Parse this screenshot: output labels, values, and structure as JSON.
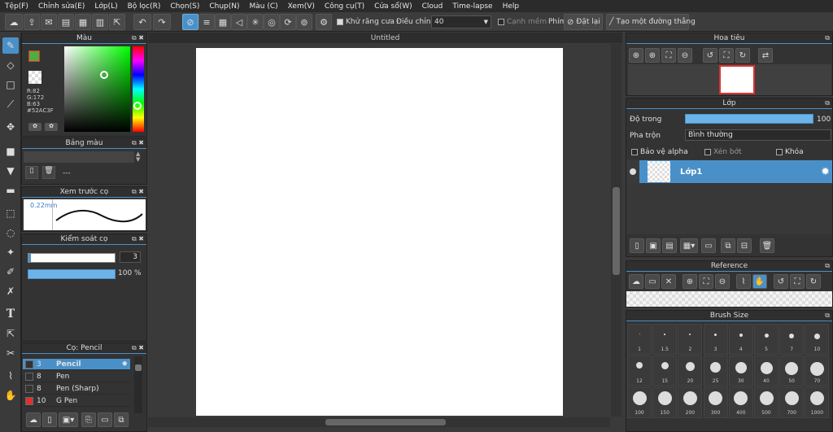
{
  "menubar": {
    "items": [
      "Tệp(F)",
      "Chỉnh sửa(E)",
      "Lớp(L)",
      "Bộ lọc(R)",
      "Chọn(S)",
      "Chụp(N)",
      "Màu (C)",
      "Xem(V)",
      "Công cụ(T)",
      "Cửa sổ(W)",
      "Cloud",
      "Time-lapse",
      "Help"
    ]
  },
  "toolbar": {
    "antialias_label": "Khử răng cưa",
    "adjust_label": "Điều chỉnh",
    "adjust_value": "40",
    "soft_edge_label": "Cạnh mềm",
    "key_label": "Phím",
    "reset_label": "Đặt lại",
    "straight_line_label": "Tạo một đường thẳng"
  },
  "color_panel": {
    "title": "Màu",
    "r": "R:82",
    "g": "G:172",
    "b": "B:63",
    "hex": "#52AC3F",
    "fg_color": "#52ac3f"
  },
  "palette_panel": {
    "title": "Bảng màu",
    "name": "---"
  },
  "brush_preview_panel": {
    "title": "Xem trước cọ",
    "size": "0.22mm"
  },
  "brush_control_panel": {
    "title": "Kiểm soát cọ",
    "size_value": "3",
    "opacity_value": "100 %"
  },
  "brush_list_panel": {
    "title": "Cọ: Pencil",
    "items": [
      {
        "size": "3",
        "name": "Pencil",
        "color": "#333333"
      },
      {
        "size": "8",
        "name": "Pen",
        "color": "#333333"
      },
      {
        "size": "8",
        "name": "Pen (Sharp)",
        "color": "#333333"
      },
      {
        "size": "10",
        "name": "G Pen",
        "color": "#e03030"
      }
    ]
  },
  "canvas": {
    "tab_title": "Untitled"
  },
  "navigator_panel": {
    "title": "Hoa tiêu"
  },
  "layer_panel": {
    "title": "Lớp",
    "opacity_label": "Độ trong",
    "opacity_value": "100 %",
    "opacity_fraction": 1.0,
    "blend_label": "Pha trộn",
    "blend_value": "Bình thường",
    "protect_alpha_label": "Bảo vệ alpha",
    "clipping_label": "Xén bớt",
    "lock_label": "Khóa",
    "layers": [
      {
        "name": "Lớp1"
      }
    ]
  },
  "reference_panel": {
    "title": "Reference"
  },
  "brush_size_panel": {
    "title": "Brush Size",
    "sizes": [
      "1",
      "1.5",
      "2",
      "3",
      "4",
      "5",
      "7",
      "10",
      "12",
      "15",
      "20",
      "25",
      "30",
      "40",
      "50",
      "70",
      "100",
      "150",
      "200",
      "300",
      "400",
      "500",
      "700",
      "1000"
    ]
  }
}
